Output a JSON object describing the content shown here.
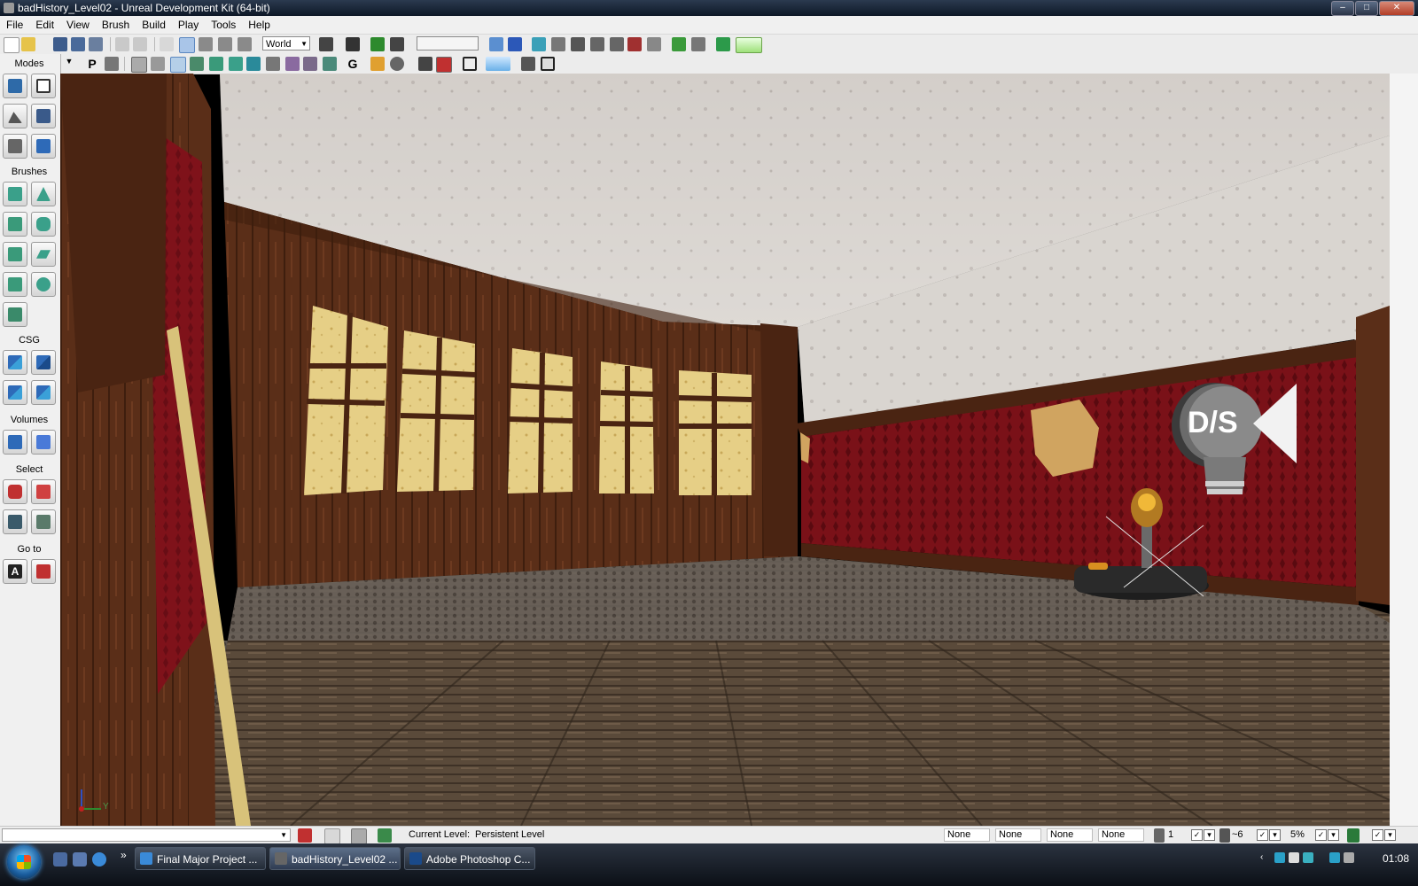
{
  "window": {
    "title": "badHistory_Level02 - Unreal Development Kit (64-bit)",
    "buttons": [
      "minimize",
      "maximize",
      "close"
    ]
  },
  "menu": [
    "File",
    "Edit",
    "View",
    "Brush",
    "Build",
    "Play",
    "Tools",
    "Help"
  ],
  "toolbar": {
    "coordinate_system": "World"
  },
  "toolbar2": {
    "letters": [
      "P",
      "G"
    ]
  },
  "modes_panel": {
    "sections": [
      "Modes",
      "Brushes",
      "CSG",
      "Volumes",
      "Select",
      "Go to"
    ],
    "goto_button_letter": "A"
  },
  "viewport": {
    "light_actor_label": "D/S",
    "axis_y_label": "Y"
  },
  "statusbar": {
    "current_level_label": "Current Level:",
    "current_level_value": "Persistent Level",
    "fields": [
      "None",
      "None",
      "None",
      "None"
    ],
    "grid_size": "1",
    "rotation_snap": "~6",
    "scale_snap": "5%"
  },
  "taskbar": {
    "buttons": [
      "Final Major Project ...",
      "badHistory_Level02 ...",
      "Adobe Photoshop C..."
    ],
    "overflow": "»",
    "clock": "01:08"
  },
  "colors": {
    "titlebar": "#0d1726",
    "wallpaper_red": "#7a1118",
    "wood": "#5a2e18",
    "ceiling": "#d8d4d0"
  }
}
